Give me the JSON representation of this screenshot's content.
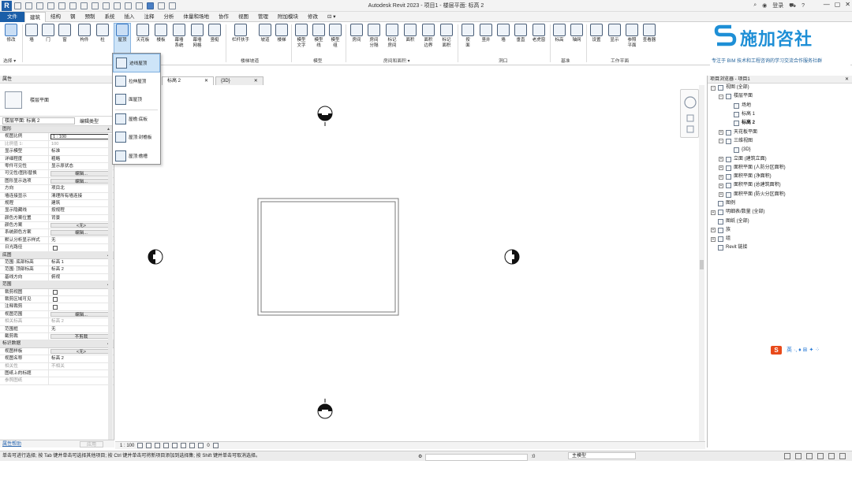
{
  "title_bar": {
    "app_letter": "R",
    "title": "Autodesk Revit 2023 - 项目1 - 楼层平面: 标高 2",
    "user": "登录",
    "help": "?",
    "controls": [
      "—",
      "▢",
      "✕"
    ]
  },
  "menu": {
    "tabs": [
      "文件",
      "建筑",
      "结构",
      "钢",
      "预制",
      "系统",
      "插入",
      "注释",
      "分析",
      "体量和场地",
      "协作",
      "视图",
      "管理",
      "附加模块",
      "修改",
      "⊡ ▾"
    ]
  },
  "ribbon": {
    "buttons": [
      {
        "label": "修改",
        "label2": ""
      },
      {
        "label": "墙",
        "label2": ""
      },
      {
        "label": "门",
        "label2": ""
      },
      {
        "label": "窗",
        "label2": ""
      },
      {
        "label": "构件",
        "label2": ""
      },
      {
        "label": "柱",
        "label2": ""
      },
      {
        "label": "屋顶",
        "label2": ""
      },
      {
        "label": "天花板",
        "label2": ""
      },
      {
        "label": "楼板",
        "label2": ""
      },
      {
        "label": "幕墙",
        "label2": "系统"
      },
      {
        "label": "幕墙",
        "label2": "网格"
      },
      {
        "label": "竖梃",
        "label2": ""
      },
      {
        "label": "栏杆扶手",
        "label2": ""
      },
      {
        "label": "坡道",
        "label2": ""
      },
      {
        "label": "楼梯",
        "label2": ""
      },
      {
        "label": "模型",
        "label2": "文字"
      },
      {
        "label": "模型",
        "label2": "线"
      },
      {
        "label": "模型",
        "label2": "组"
      },
      {
        "label": "房间",
        "label2": ""
      },
      {
        "label": "房间",
        "label2": "分隔"
      },
      {
        "label": "标记",
        "label2": "房间"
      },
      {
        "label": "面积",
        "label2": ""
      },
      {
        "label": "面积",
        "label2": "边界"
      },
      {
        "label": "标记",
        "label2": "面积"
      },
      {
        "label": "按",
        "label2": "面"
      },
      {
        "label": "竖井",
        "label2": ""
      },
      {
        "label": "墙",
        "label2": ""
      },
      {
        "label": "垂直",
        "label2": ""
      },
      {
        "label": "老虎窗",
        "label2": ""
      },
      {
        "label": "标高",
        "label2": ""
      },
      {
        "label": "轴网",
        "label2": ""
      },
      {
        "label": "设置",
        "label2": ""
      },
      {
        "label": "显示",
        "label2": ""
      },
      {
        "label": "参照",
        "label2": "平面"
      },
      {
        "label": "查看器",
        "label2": ""
      }
    ],
    "panels": [
      "选择 ▾",
      "构建",
      "楼梯坡道",
      "模型",
      "房间和面积 ▾",
      "洞口",
      "基准",
      "工作平面"
    ]
  },
  "brand": {
    "name": "施加咨社",
    "tagline": "专注于 BIM 技术和工程咨询的学习交流合作服务社群"
  },
  "roof_menu": {
    "items": [
      "迹线屋顶",
      "拉伸屋顶",
      "面屋顶",
      "屋檐:底板",
      "屋顶:封檐板",
      "屋顶:檐槽"
    ]
  },
  "properties": {
    "title": "属性",
    "type_name": "楼层平面",
    "selector": "楼层平面: 标高 2",
    "edit_type": "编辑类型",
    "rows": [
      {
        "kind": "cat",
        "label": "图形"
      },
      {
        "kind": "box",
        "k": "视图比例",
        "v": "1 : 100"
      },
      {
        "kind": "grey",
        "k": "比例值 1:",
        "v": "100"
      },
      {
        "kind": "text",
        "k": "显示模型",
        "v": "标准"
      },
      {
        "kind": "text",
        "k": "详细程度",
        "v": "粗略"
      },
      {
        "kind": "text",
        "k": "零件可见性",
        "v": "显示原状态"
      },
      {
        "kind": "btn",
        "k": "可见性/图形替换",
        "v": "编辑..."
      },
      {
        "kind": "btn",
        "k": "图形显示选项",
        "v": "编辑..."
      },
      {
        "kind": "text",
        "k": "方向",
        "v": "项目北"
      },
      {
        "kind": "text",
        "k": "墙连接显示",
        "v": "清理所有墙连接"
      },
      {
        "kind": "text",
        "k": "规程",
        "v": "建筑"
      },
      {
        "kind": "text",
        "k": "显示隐藏线",
        "v": "按规程"
      },
      {
        "kind": "text",
        "k": "颜色方案位置",
        "v": "背景"
      },
      {
        "kind": "btn",
        "k": "颜色方案",
        "v": "<无>"
      },
      {
        "kind": "btn",
        "k": "系统颜色方案",
        "v": "编辑..."
      },
      {
        "kind": "text",
        "k": "默认分析显示样式",
        "v": "无"
      },
      {
        "kind": "check",
        "k": "日光路径",
        "v": ""
      },
      {
        "kind": "cat",
        "label": "底图"
      },
      {
        "kind": "text",
        "k": "范围: 底部标高",
        "v": "标高 1"
      },
      {
        "kind": "text",
        "k": "范围: 顶部标高",
        "v": "标高 2"
      },
      {
        "kind": "text",
        "k": "基线方向",
        "v": "俯视"
      },
      {
        "kind": "cat",
        "label": "范围"
      },
      {
        "kind": "check",
        "k": "裁剪视图",
        "v": ""
      },
      {
        "kind": "check",
        "k": "裁剪区域可见",
        "v": ""
      },
      {
        "kind": "check",
        "k": "注释裁剪",
        "v": ""
      },
      {
        "kind": "btn",
        "k": "视图范围",
        "v": "编辑..."
      },
      {
        "kind": "grey",
        "k": "相关标高",
        "v": "标高 2"
      },
      {
        "kind": "text",
        "k": "范围框",
        "v": "无"
      },
      {
        "kind": "btn",
        "k": "截剪裁",
        "v": "不剪裁"
      },
      {
        "kind": "cat",
        "label": "标识数据"
      },
      {
        "kind": "btn",
        "k": "视图样板",
        "v": "<无>"
      },
      {
        "kind": "text",
        "k": "视图名称",
        "v": "标高 2"
      },
      {
        "kind": "grey",
        "k": "相关性",
        "v": "不相关"
      },
      {
        "kind": "text",
        "k": "图纸上的标题",
        "v": ""
      },
      {
        "kind": "grey",
        "k": "参照图纸",
        "v": ""
      }
    ],
    "help_link": "属性帮助",
    "apply": "应用"
  },
  "view_tabs": [
    {
      "label": "标高 2",
      "close": "✕"
    },
    {
      "label": "{3D}",
      "close": "✕"
    }
  ],
  "project_browser": {
    "title": "项目浏览器 - 项目1",
    "close": "✕",
    "tree": [
      {
        "indent": 0,
        "tog": "−",
        "label": "视图 (全部)",
        "bold": false
      },
      {
        "indent": 1,
        "tog": "−",
        "label": "楼层平面",
        "bold": false
      },
      {
        "indent": 2,
        "tog": "",
        "label": "场地",
        "bold": false
      },
      {
        "indent": 2,
        "tog": "",
        "label": "标高 1",
        "bold": false
      },
      {
        "indent": 2,
        "tog": "",
        "label": "标高 2",
        "bold": true
      },
      {
        "indent": 1,
        "tog": "+",
        "label": "天花板平面",
        "bold": false
      },
      {
        "indent": 1,
        "tog": "−",
        "label": "三维视图",
        "bold": false
      },
      {
        "indent": 2,
        "tog": "",
        "label": "{3D}",
        "bold": false
      },
      {
        "indent": 1,
        "tog": "+",
        "label": "立面 (建筑立面)",
        "bold": false
      },
      {
        "indent": 1,
        "tog": "+",
        "label": "面积平面 (人防分区面积)",
        "bold": false
      },
      {
        "indent": 1,
        "tog": "+",
        "label": "面积平面 (净面积)",
        "bold": false
      },
      {
        "indent": 1,
        "tog": "+",
        "label": "面积平面 (总建筑面积)",
        "bold": false
      },
      {
        "indent": 1,
        "tog": "+",
        "label": "面积平面 (防火分区面积)",
        "bold": false
      },
      {
        "indent": 0,
        "tog": "",
        "label": "图例",
        "bold": false
      },
      {
        "indent": 0,
        "tog": "+",
        "label": "明细表/数量 (全部)",
        "bold": false
      },
      {
        "indent": 0,
        "tog": "",
        "label": "图纸 (全部)",
        "bold": false
      },
      {
        "indent": 0,
        "tog": "+",
        "label": "族",
        "bold": false
      },
      {
        "indent": 0,
        "tog": "+",
        "label": "组",
        "bold": false
      },
      {
        "indent": 0,
        "tog": "",
        "label": "Revit 链接",
        "bold": false
      }
    ]
  },
  "ime": {
    "logo": "S",
    "text": "英 ·, ♦ ⊞ ✦ ⁘"
  },
  "view_control": {
    "scale": "1 : 100",
    "hidden": "0"
  },
  "status": {
    "message": "单击可进行选择; 按 Tab 键并单击可选择其他项目; 按 Ctrl 键并单击可将新项目添加到选择集; 按 Shift 键并单击可取消选择。",
    "zero": ":0",
    "model": "主模型",
    "filter": "▽:0"
  },
  "colors": {
    "accent": "#1a5ea8",
    "brand": "#1e8fd6",
    "hover": "#cde4f8"
  }
}
